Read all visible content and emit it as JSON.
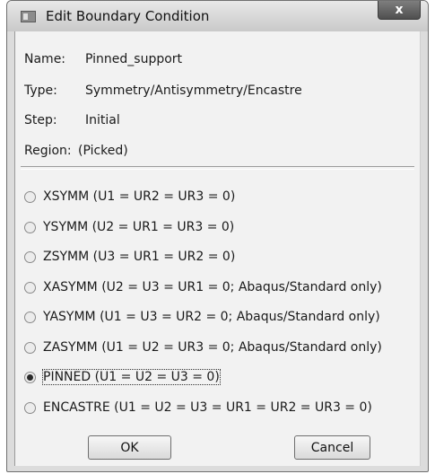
{
  "window": {
    "title": "Edit Boundary Condition",
    "close_label": "x"
  },
  "info": {
    "name_label": "Name:",
    "name_value": "Pinned_support",
    "type_label": "Type:",
    "type_value": "Symmetry/Antisymmetry/Encastre",
    "step_label": "Step:",
    "step_value": "Initial",
    "region_label": "Region:",
    "region_value": "(Picked)"
  },
  "options": [
    {
      "label": "XSYMM (U1 = UR2 = UR3 = 0)",
      "selected": false
    },
    {
      "label": "YSYMM (U2 = UR1 = UR3 = 0)",
      "selected": false
    },
    {
      "label": "ZSYMM (U3 = UR1 = UR2 = 0)",
      "selected": false
    },
    {
      "label": "XASYMM (U2 = U3 = UR1 = 0; Abaqus/Standard only)",
      "selected": false
    },
    {
      "label": "YASYMM (U1 = U3 = UR2 = 0; Abaqus/Standard only)",
      "selected": false
    },
    {
      "label": "ZASYMM (U1 = U2 = UR3 = 0; Abaqus/Standard only)",
      "selected": false
    },
    {
      "label": "PINNED (U1 = U2 = U3 = 0)",
      "selected": true
    },
    {
      "label": "ENCASTRE (U1 = U2 = U3 = UR1 = UR2 = UR3 = 0)",
      "selected": false
    }
  ],
  "buttons": {
    "ok_label": "OK",
    "cancel_label": "Cancel"
  }
}
